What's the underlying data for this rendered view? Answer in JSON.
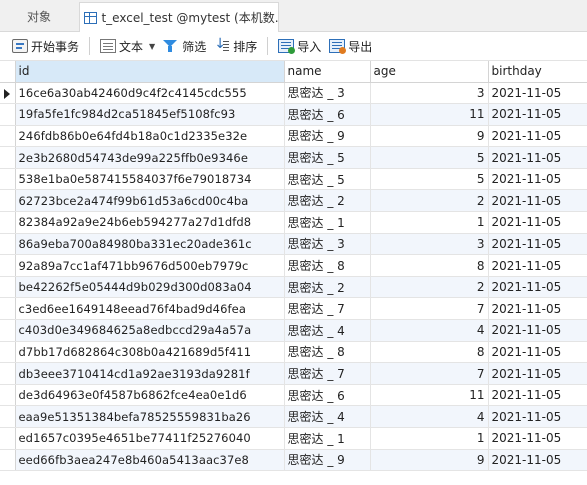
{
  "tabs": {
    "objects_label": "对象",
    "table_label": "t_excel_test @mytest (本机数..."
  },
  "toolbar": {
    "begin_tx": "开始事务",
    "text": "文本",
    "filter": "筛选",
    "sort": "排序",
    "import": "导入",
    "export": "导出"
  },
  "columns": [
    "id",
    "name",
    "age",
    "birthday"
  ],
  "selected_column": "id",
  "current_row_index": 0,
  "rows": [
    {
      "id": "16ce6a30ab42460d9c4f2c4145cdc555",
      "name": "思密达 _ 3",
      "age": "3",
      "birthday": "2021-11-05"
    },
    {
      "id": "19fa5fe1fc984d2ca51845ef5108fc93",
      "name": "思密达 _ 6",
      "age": "11",
      "birthday": "2021-11-05"
    },
    {
      "id": "246fdb86b0e64fd4b18a0c1d2335e32e",
      "name": "思密达 _ 9",
      "age": "9",
      "birthday": "2021-11-05"
    },
    {
      "id": "2e3b2680d54743de99a225ffb0e9346e",
      "name": "思密达 _ 5",
      "age": "5",
      "birthday": "2021-11-05"
    },
    {
      "id": "538e1ba0e587415584037f6e79018734",
      "name": "思密达 _ 5",
      "age": "5",
      "birthday": "2021-11-05"
    },
    {
      "id": "62723bce2a474f99b61d53a6cd00c4ba",
      "name": "思密达 _ 2",
      "age": "2",
      "birthday": "2021-11-05"
    },
    {
      "id": "82384a92a9e24b6eb594277a27d1dfd8",
      "name": "思密达 _ 1",
      "age": "1",
      "birthday": "2021-11-05"
    },
    {
      "id": "86a9eba700a84980ba331ec20ade361c",
      "name": "思密达 _ 3",
      "age": "3",
      "birthday": "2021-11-05"
    },
    {
      "id": "92a89a7cc1af471bb9676d500eb7979c",
      "name": "思密达 _ 8",
      "age": "8",
      "birthday": "2021-11-05"
    },
    {
      "id": "be42262f5e05444d9b029d300d083a04",
      "name": "思密达 _ 2",
      "age": "2",
      "birthday": "2021-11-05"
    },
    {
      "id": "c3ed6ee1649148eead76f4bad9d46fea",
      "name": "思密达 _ 7",
      "age": "7",
      "birthday": "2021-11-05"
    },
    {
      "id": "c403d0e349684625a8edbccd29a4a57a",
      "name": "思密达 _ 4",
      "age": "4",
      "birthday": "2021-11-05"
    },
    {
      "id": "d7bb17d682864c308b0a421689d5f411",
      "name": "思密达 _ 8",
      "age": "8",
      "birthday": "2021-11-05"
    },
    {
      "id": "db3eee3710414cd1a92ae3193da9281f",
      "name": "思密达 _ 7",
      "age": "7",
      "birthday": "2021-11-05"
    },
    {
      "id": "de3d64963e0f4587b6862fce4ea0e1d6",
      "name": "思密达 _ 6",
      "age": "11",
      "birthday": "2021-11-05"
    },
    {
      "id": "eaa9e51351384befa78525559831ba26",
      "name": "思密达 _ 4",
      "age": "4",
      "birthday": "2021-11-05"
    },
    {
      "id": "ed1657c0395e4651be77411f25276040",
      "name": "思密达 _ 1",
      "age": "1",
      "birthday": "2021-11-05"
    },
    {
      "id": "eed66fb3aea247e8b460a5413aac37e8",
      "name": "思密达 _ 9",
      "age": "9",
      "birthday": "2021-11-05"
    }
  ]
}
